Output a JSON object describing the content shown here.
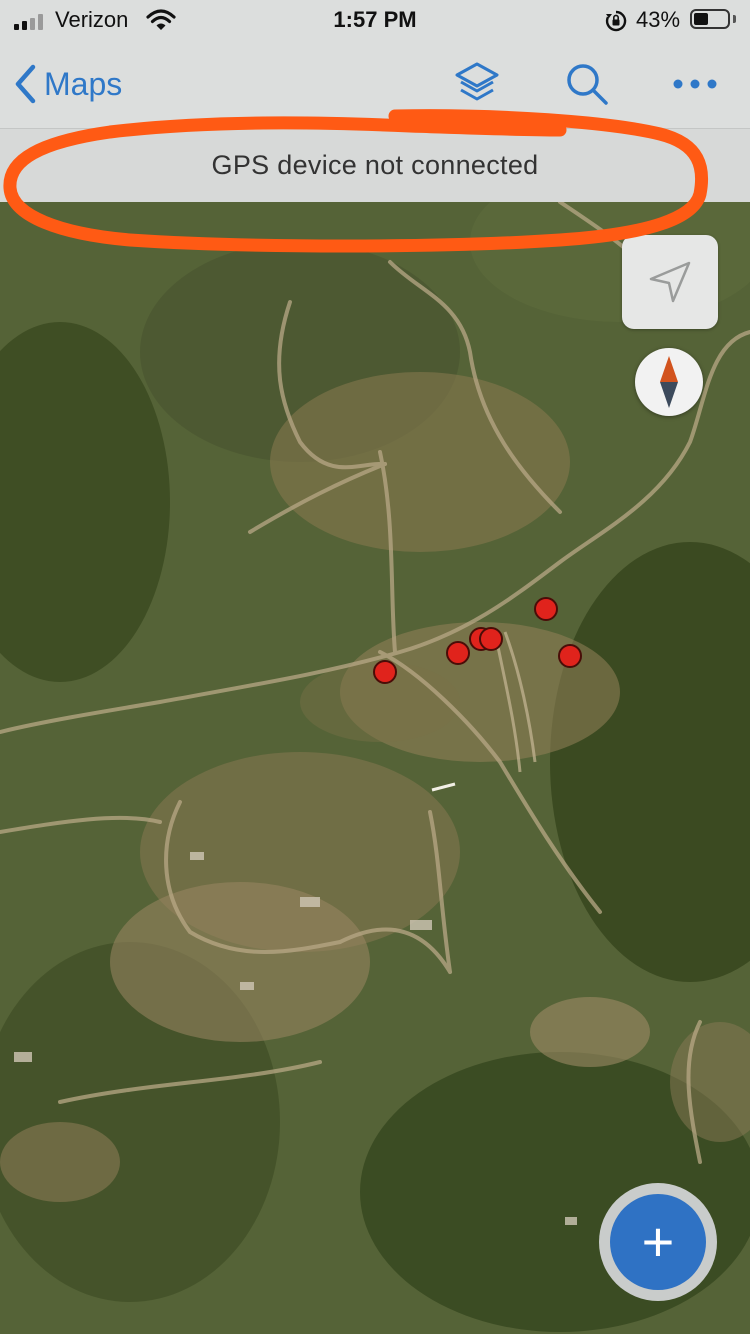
{
  "status_bar": {
    "carrier": "Verizon",
    "time": "1:57 PM",
    "battery_percent": "43%",
    "battery_level": 0.43,
    "signal_bars_filled": 2,
    "signal_bars_total": 4
  },
  "nav": {
    "back_label": "Maps",
    "icons": [
      "chevron-left-icon",
      "layers-icon",
      "search-icon",
      "more-icon"
    ],
    "accent_color": "#2f78c8"
  },
  "banner": {
    "message": "GPS device not connected",
    "annotation_color": "#ff5a14"
  },
  "map": {
    "type": "satellite",
    "controls": [
      "locate-icon",
      "compass-icon"
    ],
    "marker_color": "#e0231c",
    "marker_count": 7
  },
  "fab": {
    "label": "+",
    "color": "#2f72c4"
  }
}
